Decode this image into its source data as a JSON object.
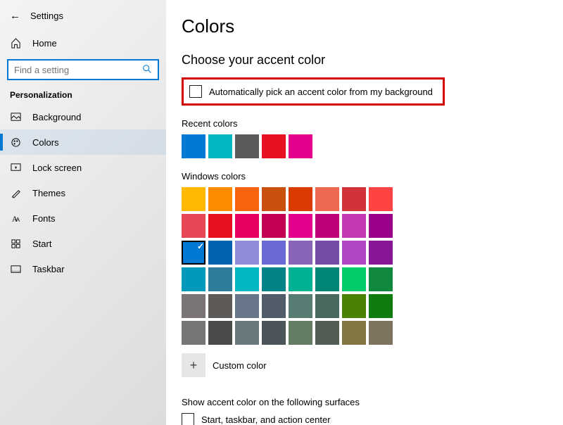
{
  "app_title": "Settings",
  "home_label": "Home",
  "search_placeholder": "Find a setting",
  "category": "Personalization",
  "nav": [
    {
      "label": "Background",
      "active": false
    },
    {
      "label": "Colors",
      "active": true
    },
    {
      "label": "Lock screen",
      "active": false
    },
    {
      "label": "Themes",
      "active": false
    },
    {
      "label": "Fonts",
      "active": false
    },
    {
      "label": "Start",
      "active": false
    },
    {
      "label": "Taskbar",
      "active": false
    }
  ],
  "page_title": "Colors",
  "accent_section": "Choose your accent color",
  "auto_pick_label": "Automatically pick an accent color from my background",
  "recent_label": "Recent colors",
  "recent_colors": [
    "#0078d4",
    "#00b7c3",
    "#5b5b5b",
    "#e81123",
    "#e3008c"
  ],
  "windows_label": "Windows colors",
  "windows_colors": [
    [
      "#ffb900",
      "#ff8c00",
      "#f7630c",
      "#ca5010",
      "#da3b01",
      "#ef6950",
      "#d13438",
      "#ff4343"
    ],
    [
      "#e74856",
      "#e81123",
      "#ea005e",
      "#c30052",
      "#e3008c",
      "#bf0077",
      "#c239b3",
      "#9a0089"
    ],
    [
      "#0078d4",
      "#0063b1",
      "#8e8cd8",
      "#6b69d6",
      "#8764b8",
      "#744da9",
      "#b146c2",
      "#881798"
    ],
    [
      "#0099bc",
      "#2d7d9a",
      "#00b7c3",
      "#038387",
      "#00b294",
      "#018574",
      "#00cc6a",
      "#10893e"
    ],
    [
      "#7a7574",
      "#5d5a58",
      "#68768a",
      "#515c6b",
      "#567c73",
      "#486860",
      "#498205",
      "#107c10"
    ],
    [
      "#767676",
      "#4c4a48",
      "#69797e",
      "#4a5459",
      "#647c64",
      "#525e54",
      "#847545",
      "#7e735f"
    ]
  ],
  "selected_color": "#0078d4",
  "custom_label": "Custom color",
  "surfaces_title": "Show accent color on the following surfaces",
  "surface_item_label": "Start, taskbar, and action center"
}
